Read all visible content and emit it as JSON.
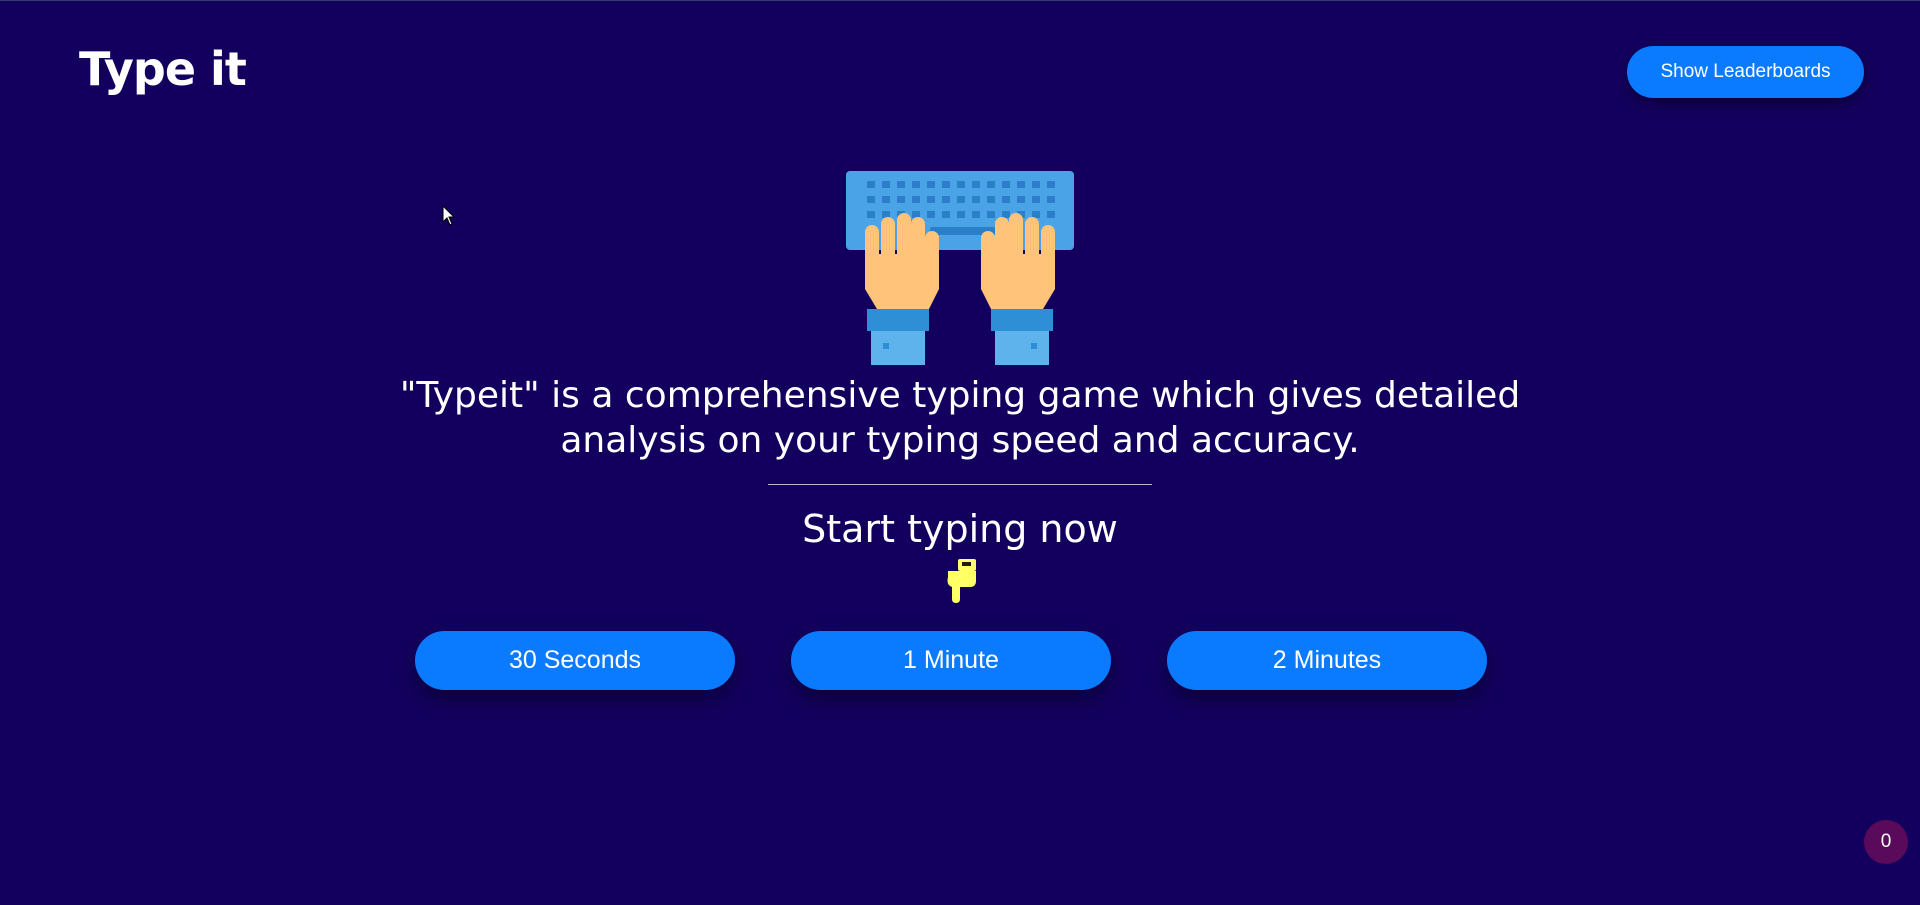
{
  "header": {
    "logo_text": "Type it",
    "leaderboards_button": "Show Leaderboards"
  },
  "hero": {
    "illustration": "keyboard-hands-icon",
    "headline": "\"Typeit\" is a comprehensive typing game which gives detailed analysis on your typing speed and accuracy.",
    "subhead": "Start typing now",
    "pointer_icon": "pointing-down-hand-icon"
  },
  "durations": [
    {
      "label": "30 Seconds"
    },
    {
      "label": "1 Minute"
    },
    {
      "label": "2 Minutes"
    }
  ],
  "counter": {
    "value": "0"
  },
  "colors": {
    "background": "#13005e",
    "accent": "#0a7bff",
    "counter_bg": "#5a0a5a",
    "pointer": "#ffff66"
  }
}
